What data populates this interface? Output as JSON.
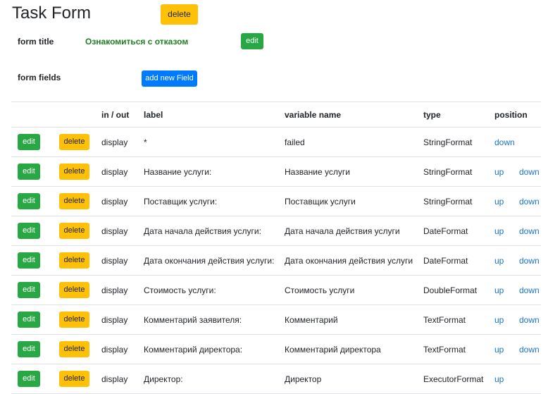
{
  "page": {
    "title": "Task Form",
    "delete_label": "delete"
  },
  "form_title": {
    "label": "form title",
    "value": "Ознакомиться с отказом",
    "edit_label": "edit"
  },
  "form_fields": {
    "label": "form fields",
    "add_label": "add new Field"
  },
  "table": {
    "headers": [
      "",
      "",
      "in / out",
      "label",
      "variable name",
      "type",
      "position"
    ],
    "edit_label": "edit",
    "delete_label": "delete",
    "up_label": "up",
    "down_label": "down",
    "rows": [
      {
        "io": "display",
        "label": "*",
        "variable": "failed",
        "type": "StringFormat"
      },
      {
        "io": "display",
        "label": "Название услуги:",
        "variable": "Название услуги",
        "type": "StringFormat"
      },
      {
        "io": "display",
        "label": "Поставщик услуги:",
        "variable": "Поставщик услуги",
        "type": "StringFormat"
      },
      {
        "io": "display",
        "label": "Дата начала действия услуги:",
        "variable": "Дата начала действия услуги",
        "type": "DateFormat"
      },
      {
        "io": "display",
        "label": "Дата окончания действия услуги:",
        "variable": "Дата окончания действия услуги",
        "type": "DateFormat"
      },
      {
        "io": "display",
        "label": "Стоимость услуги:",
        "variable": "Стоимость услуги",
        "type": "DoubleFormat"
      },
      {
        "io": "display",
        "label": "Комментарий заявителя:",
        "variable": "Комментарий",
        "type": "TextFormat"
      },
      {
        "io": "display",
        "label": "Комментарий директора:",
        "variable": "Комментарий директора",
        "type": "TextFormat"
      },
      {
        "io": "display",
        "label": "Директор:",
        "variable": "Директор",
        "type": "ExecutorFormat"
      }
    ]
  }
}
